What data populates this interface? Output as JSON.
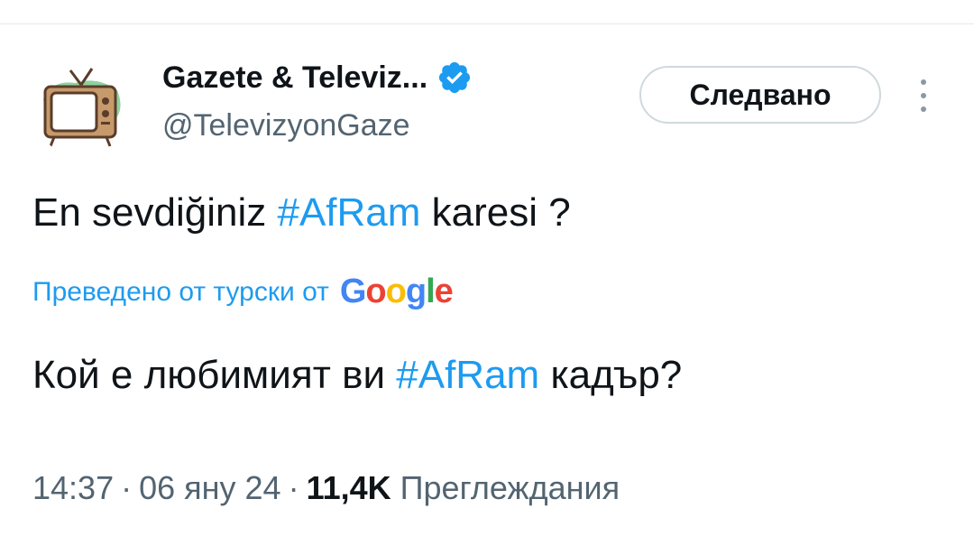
{
  "author": {
    "display_name": "Gazete & Televiz...",
    "handle": "@TelevizyonGaze",
    "verified": true,
    "avatar_icon": "retro-tv-icon"
  },
  "actions": {
    "follow_label": "Следвано",
    "more_icon": "more-vertical-icon"
  },
  "tweet": {
    "text_before": "En sevdiğiniz ",
    "hashtag": "#AfRam",
    "text_after": " karesi ?"
  },
  "translation": {
    "link_text": "Преведено от турски от",
    "provider_letters": [
      "G",
      "o",
      "o",
      "g",
      "l",
      "e"
    ],
    "text_before": "Кой е любимият ви ",
    "hashtag": "#AfRam",
    "text_after": " кадър?"
  },
  "meta": {
    "time": "14:37",
    "separator": "·",
    "date": "06 яну 24",
    "views_count": "11,4K",
    "views_label": "Преглеждания"
  },
  "colors": {
    "accent": "#1d9bf0",
    "text_primary": "#0f1419",
    "text_secondary": "#536471",
    "border": "#cfd9de"
  }
}
